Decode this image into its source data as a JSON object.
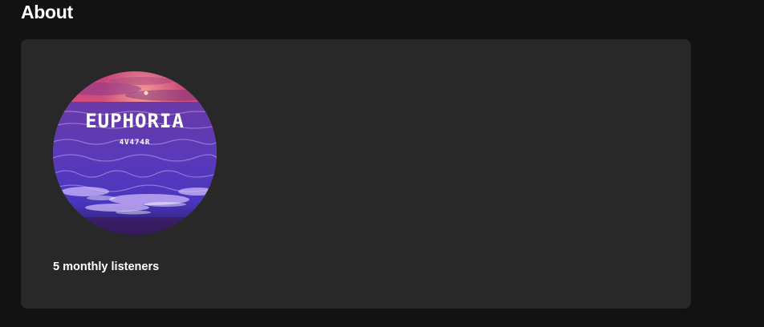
{
  "section": {
    "title": "About"
  },
  "artist_image": {
    "title_text": "EUPHORIA",
    "subtitle_text": "4V474R"
  },
  "stats": {
    "monthly_listeners": "5 monthly listeners"
  },
  "colors": {
    "page_bg": "#121212",
    "card_bg": "#282828",
    "text": "#ffffff"
  }
}
